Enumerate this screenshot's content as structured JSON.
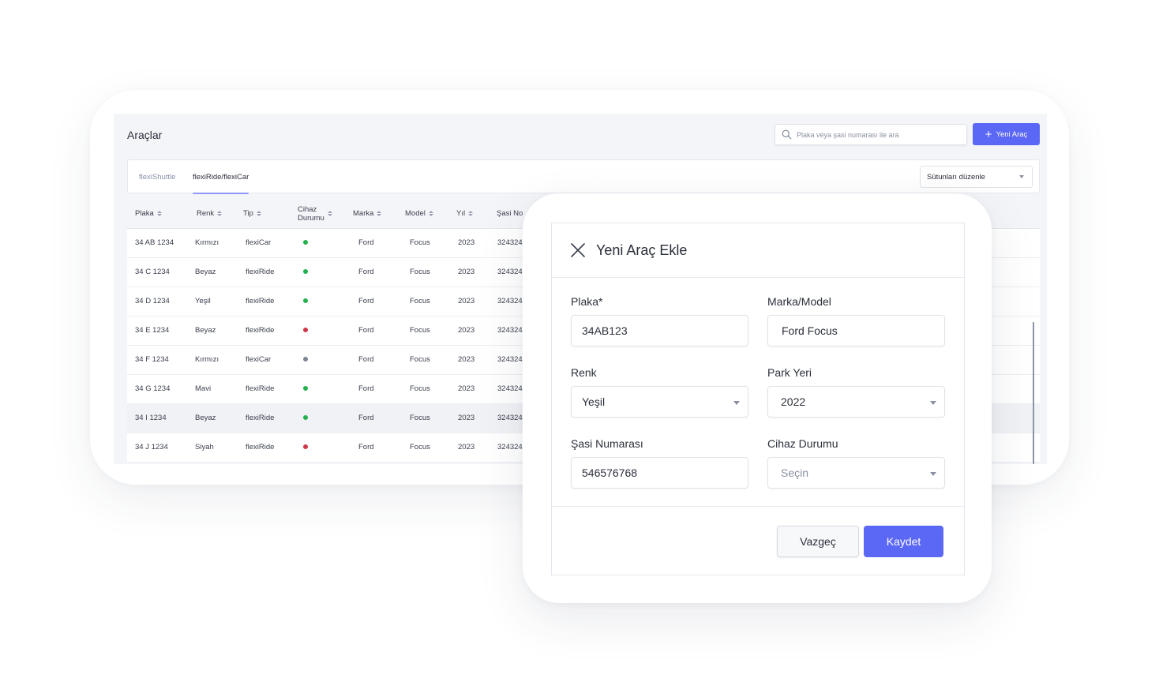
{
  "app": {
    "title": "Araçlar",
    "search": {
      "placeholder": "Plaka veya şasi numarası ile ara",
      "value": ""
    },
    "new_button": {
      "icon": "plus-icon",
      "label": "Yeni Araç"
    },
    "tabs": [
      {
        "label": "flexiShuttle",
        "active": false
      },
      {
        "label": "flexiRide/flexiCar",
        "active": true
      }
    ],
    "column_select": {
      "label": "Sütunları düzenle",
      "icon": "caret-down-icon"
    },
    "table": {
      "columns": [
        {
          "key": "plaka",
          "label": "Plaka"
        },
        {
          "key": "renk",
          "label": "Renk"
        },
        {
          "key": "tip",
          "label": "Tip"
        },
        {
          "key": "cihaz",
          "label_line1": "Cihaz",
          "label_line2": "Durumu"
        },
        {
          "key": "marka",
          "label": "Marka"
        },
        {
          "key": "model",
          "label": "Model"
        },
        {
          "key": "yil",
          "label": "Yıl"
        },
        {
          "key": "sasi",
          "label": "Şasi No"
        }
      ],
      "rows": [
        {
          "plaka": "34 AB 1234",
          "renk": "Kırmızı",
          "tip": "flexiCar",
          "status": "green",
          "marka": "Ford",
          "model": "Focus",
          "yil": "2023",
          "sasi": "324324"
        },
        {
          "plaka": "34 C 1234",
          "renk": "Beyaz",
          "tip": "flexiRide",
          "status": "green",
          "marka": "Ford",
          "model": "Focus",
          "yil": "2023",
          "sasi": "324324"
        },
        {
          "plaka": "34 D 1234",
          "renk": "Yeşil",
          "tip": "flexiRide",
          "status": "green",
          "marka": "Ford",
          "model": "Focus",
          "yil": "2023",
          "sasi": "324324"
        },
        {
          "plaka": "34 E 1234",
          "renk": "Beyaz",
          "tip": "flexiRide",
          "status": "red",
          "marka": "Ford",
          "model": "Focus",
          "yil": "2023",
          "sasi": "324324"
        },
        {
          "plaka": "34 F 1234",
          "renk": "Kırmızı",
          "tip": "flexiCar",
          "status": "gray",
          "marka": "Ford",
          "model": "Focus",
          "yil": "2023",
          "sasi": "324324"
        },
        {
          "plaka": "34 G 1234",
          "renk": "Mavi",
          "tip": "flexiRide",
          "status": "green",
          "marka": "Ford",
          "model": "Focus",
          "yil": "2023",
          "sasi": "324324"
        },
        {
          "plaka": "34 I 1234",
          "renk": "Beyaz",
          "tip": "flexiRide",
          "status": "green",
          "marka": "Ford",
          "model": "Focus",
          "yil": "2023",
          "sasi": "324324",
          "highlighted": true
        },
        {
          "plaka": "34 J 1234",
          "renk": "Siyah",
          "tip": "flexiRide",
          "status": "red",
          "marka": "Ford",
          "model": "Focus",
          "yil": "2023",
          "sasi": "324324"
        }
      ]
    }
  },
  "modal": {
    "title": "Yeni Araç Ekle",
    "close_icon": "close-icon",
    "fields": {
      "plaka": {
        "label": "Plaka*",
        "value": "34AB123"
      },
      "marka_model": {
        "label": "Marka/Model",
        "value": "Ford Focus"
      },
      "renk": {
        "label": "Renk",
        "value": "Yeşil"
      },
      "park_yeri": {
        "label": "Park Yeri",
        "value": "2022"
      },
      "sasi": {
        "label": "Şasi Numarası",
        "value": "546576768"
      },
      "cihaz": {
        "label": "Cihaz Durumu",
        "placeholder": "Seçin"
      }
    },
    "cancel_label": "Vazgeç",
    "save_label": "Kaydet"
  },
  "colors": {
    "accent": "#5b67f5",
    "status_green": "#22b14c",
    "status_red": "#d0384a",
    "status_gray": "#7d8494"
  }
}
